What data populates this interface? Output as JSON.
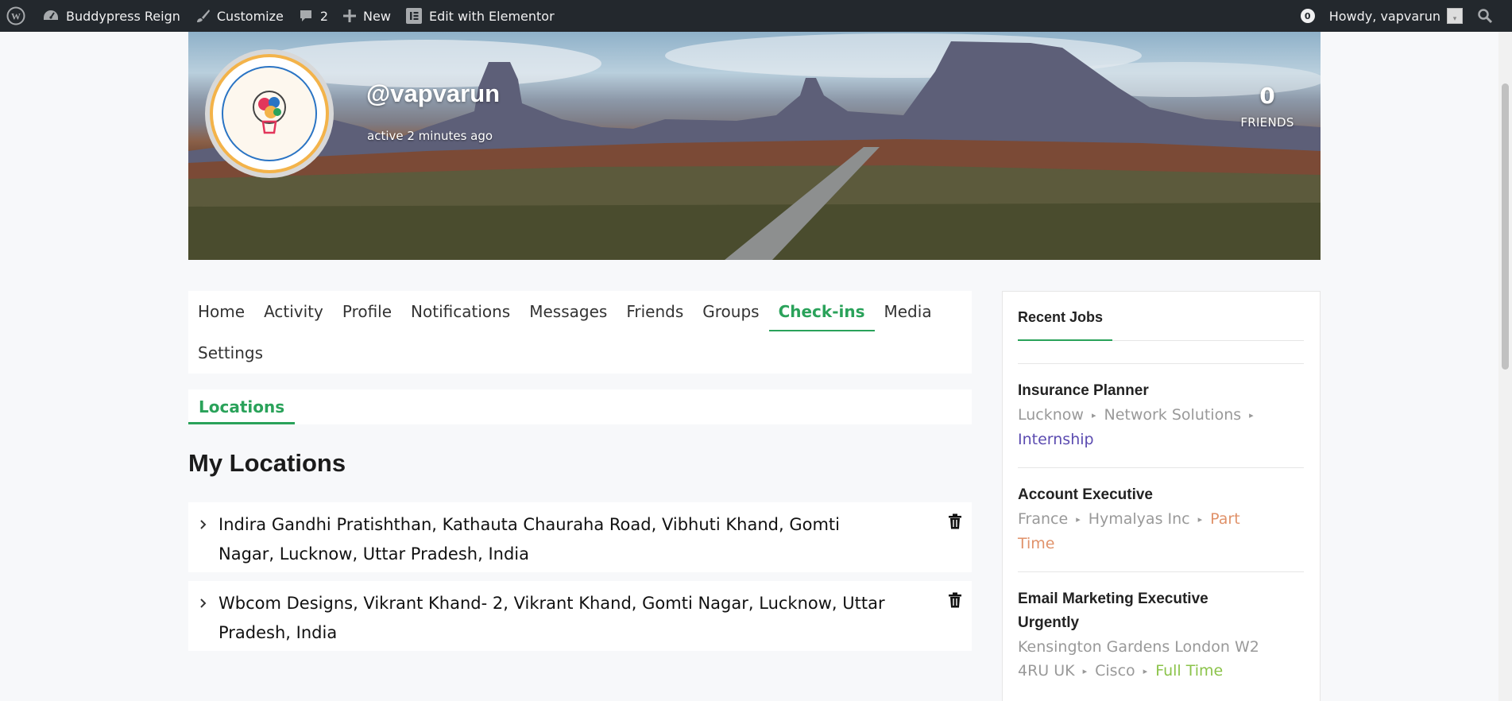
{
  "adminbar": {
    "site_name": "Buddypress Reign",
    "customize": "Customize",
    "comments_count": "2",
    "new": "New",
    "elementor": "Edit with Elementor",
    "notifications_count": "0",
    "howdy": "Howdy, vapvarun",
    "bg_color": "#23282d"
  },
  "profile": {
    "username": "@vapvarun",
    "last_active": "active 2 minutes ago",
    "friends_count": "0",
    "friends_label": "FRIENDS"
  },
  "nav": {
    "items": [
      {
        "label": "Home"
      },
      {
        "label": "Activity"
      },
      {
        "label": "Profile"
      },
      {
        "label": "Notifications"
      },
      {
        "label": "Messages"
      },
      {
        "label": "Friends"
      },
      {
        "label": "Groups"
      },
      {
        "label": "Check-ins",
        "active": true
      },
      {
        "label": "Media"
      },
      {
        "label": "Settings"
      }
    ],
    "active_color": "#2aa25a"
  },
  "subnav": {
    "active": "Locations"
  },
  "main": {
    "title": "My Locations",
    "locations": [
      {
        "line1": "Indira Gandhi Pratishthan, Kathauta Chauraha Road, Vibhuti Khand, Gomti",
        "line2": "Nagar, Lucknow, Uttar Pradesh, India"
      },
      {
        "line1": "Wbcom Designs, Vikrant Khand- 2, Vikrant Khand, Gomti Nagar, Lucknow, Uttar",
        "line2": "Pradesh, India"
      }
    ]
  },
  "sidebar": {
    "widget_title": "Recent Jobs",
    "jobs": [
      {
        "title": "Insurance Planner",
        "location": "Lucknow",
        "company": "Network Solutions",
        "type": "Internship",
        "type_color": "#5b4bb0"
      },
      {
        "title": "Account Executive",
        "location": "France",
        "company": "Hymalyas Inc",
        "type_part1": "Part",
        "type_part2": "Time",
        "type_color": "#e0926a"
      },
      {
        "title_line1": "Email Marketing Executive",
        "title_line2": "Urgently",
        "location_line1": "Kensington Gardens London W2",
        "location_line2": "4RU UK",
        "company": "Cisco",
        "type": "Full Time",
        "type_color": "#8bc34a"
      }
    ]
  },
  "icons": [
    "wordpress-icon",
    "dashboard-icon",
    "brush-icon",
    "comment-icon",
    "plus-icon",
    "elementor-icon",
    "search-icon",
    "chevron-right-icon",
    "trash-icon"
  ]
}
